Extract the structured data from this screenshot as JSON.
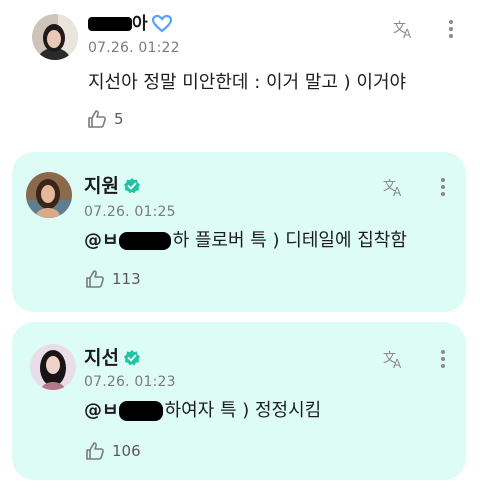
{
  "comments": [
    {
      "author_visible_suffix": "아",
      "timestamp": "07.26. 01:22",
      "text": "지선아 정말 미안한데 : 이거 말고 ) 이거야",
      "likes": "5",
      "badge": "heart-badge-icon"
    },
    {
      "author": "지원",
      "timestamp": "07.26. 01:25",
      "mention_visible": "@ㅂ",
      "text": "하 플로버 특 ) 디테일에 집착함",
      "likes": "113",
      "badge": "verified-check-icon"
    },
    {
      "author": "지선",
      "timestamp": "07.26. 01:23",
      "mention_visible": "@ㅂ",
      "text": "하여자 특 ) 정정시킴",
      "likes": "106",
      "badge": "verified-check-icon"
    }
  ],
  "colors": {
    "reply_card": "#defcf6",
    "verified": "#21c3a4",
    "heart_badge": "#5aa0ff"
  },
  "icons": [
    "translate-icon",
    "more-options-icon",
    "like-icon",
    "verified-check-icon",
    "heart-badge-icon"
  ]
}
